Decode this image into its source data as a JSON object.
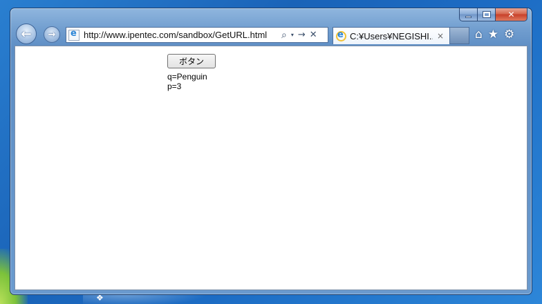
{
  "browser": {
    "address_url": "http://www.ipentec.com/sandbox/GetURL.html",
    "tab_title": "C:¥Users¥NEGISHI...",
    "tab_close_glyph": "×",
    "caption": {
      "close_glyph": "✕"
    },
    "nav": {
      "back_glyph": "←",
      "forward_glyph": "→"
    },
    "address_controls": {
      "search_glyph": "⌕",
      "dropdown_glyph": "▾",
      "go_glyph": "→",
      "stop_glyph": "✕"
    },
    "icons": {
      "home_glyph": "⌂",
      "favorites_glyph": "★",
      "tools_glyph": "⚙"
    }
  },
  "page": {
    "button_label": "ボタン",
    "lines": [
      "q=Penguin",
      "p=3"
    ]
  }
}
